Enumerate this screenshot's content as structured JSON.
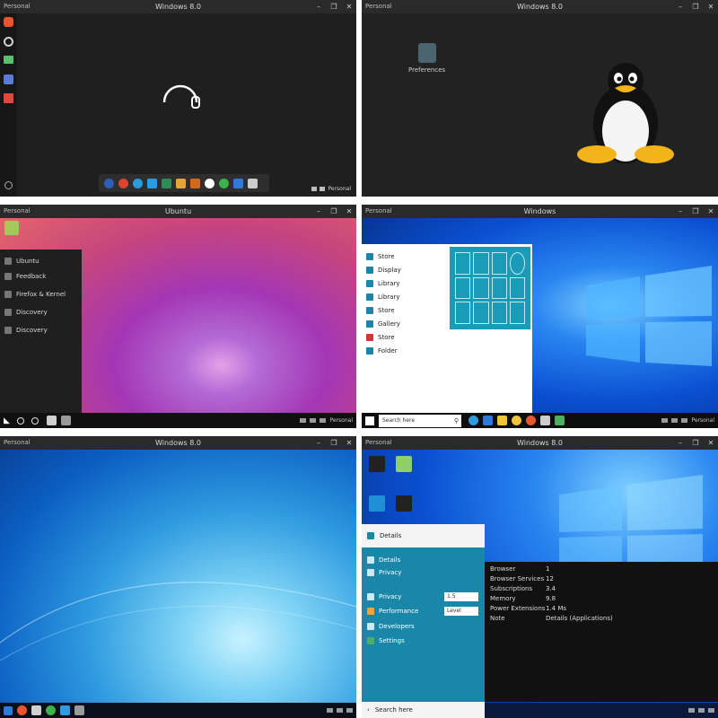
{
  "panels": [
    {
      "title": "Windows 8.0",
      "corner": "Personal",
      "sidebar_icons": [
        {
          "icon": "brave-icon",
          "color": "#e9552f"
        },
        {
          "icon": "chat-icon",
          "color": "#d0d0d0"
        },
        {
          "icon": "folder-icon",
          "color": "#5ac06d"
        },
        {
          "icon": "edit-icon",
          "color": "#5a7bd6"
        },
        {
          "icon": "document-icon",
          "color": "#d94c3d"
        }
      ],
      "dock_icons": [
        "#2b5fb8",
        "#d9442f",
        "#2c9be0",
        "#2c9be0",
        "#2e8c5a",
        "#e8a23b",
        "#d06a1e",
        "#ffffff",
        "#3bb34a",
        "#2c7bd6",
        "#cccccc"
      ],
      "tray_text": "Personal"
    },
    {
      "title": "Windows 8.0",
      "corner": "Personal",
      "desktop_icon_label": "Preferences"
    },
    {
      "title": "Ubuntu",
      "corner": "Personal",
      "menu_items": [
        "Ubuntu",
        "Feedback",
        "Firefox & Kernel",
        "Discovery",
        "Discovery"
      ],
      "tray_text": "Personal"
    },
    {
      "title": "Windows",
      "corner": "Personal",
      "start_items": [
        "Store",
        "Display",
        "Library",
        "Library",
        "Store",
        "Gallery",
        "Store",
        "Folder"
      ],
      "search_placeholder": "Search here",
      "tray_text": "Personal"
    },
    {
      "title": "Windows 8.0",
      "corner": "Personal"
    },
    {
      "title": "Windows 8.0",
      "corner": "Personal",
      "start_header": "Details",
      "start_items": [
        "Details",
        "Privacy",
        "Privacy",
        "Performance",
        "Developers",
        "Settings"
      ],
      "field_values": [
        "1.5",
        "Level"
      ],
      "info_rows": [
        {
          "label": "Browser",
          "value": "1"
        },
        {
          "label": "Browser Services",
          "value": "12"
        },
        {
          "label": "Subscriptions",
          "value": "3.4"
        },
        {
          "label": "Memory",
          "value": "9.8"
        },
        {
          "label": "Power Extensions",
          "value": "1.4 Ms"
        },
        {
          "label": "Note",
          "value": "Details (Applications)"
        }
      ],
      "search_placeholder": "Search here"
    }
  ],
  "colors": {
    "dark_bg": "#1e1e1e",
    "win_blue": "#0a4fd1",
    "teal_menu": "#1a87a8",
    "ubuntu_purple": "#8a2fa5",
    "ubuntu_pink": "#e05583"
  }
}
